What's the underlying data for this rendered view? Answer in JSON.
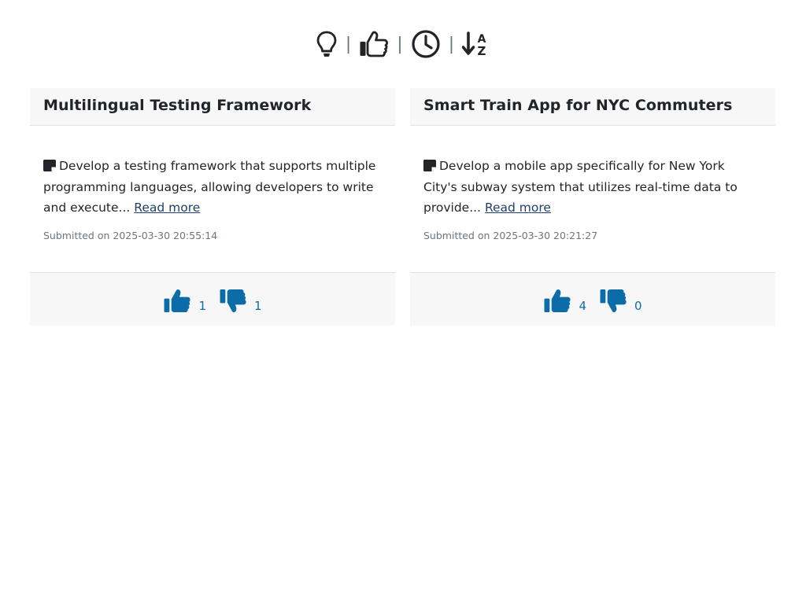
{
  "toolbar": {
    "icons": [
      "lightbulb-icon",
      "thumbs-up-icon",
      "clock-icon",
      "sort-alpha-down-icon"
    ],
    "separator": "|"
  },
  "colors": {
    "accent": "#0c6ca8",
    "link": "#1f3f6e",
    "icon_dark": "#212529",
    "muted": "#6c757d"
  },
  "cards": [
    {
      "title": "Multilingual Testing Framework",
      "description": "Develop a testing framework that supports multiple programming languages, allowing developers to write and execute...",
      "read_more": "Read more",
      "submitted": "Submitted on 2025-03-30 20:55:14",
      "upvotes": "1",
      "downvotes": "1"
    },
    {
      "title": "Smart Train App for NYC Commuters",
      "description": "Develop a mobile app specifically for New York City's subway system that utilizes real-time data to provide...",
      "read_more": "Read more",
      "submitted": "Submitted on 2025-03-30 20:21:27",
      "upvotes": "4",
      "downvotes": "0"
    }
  ]
}
